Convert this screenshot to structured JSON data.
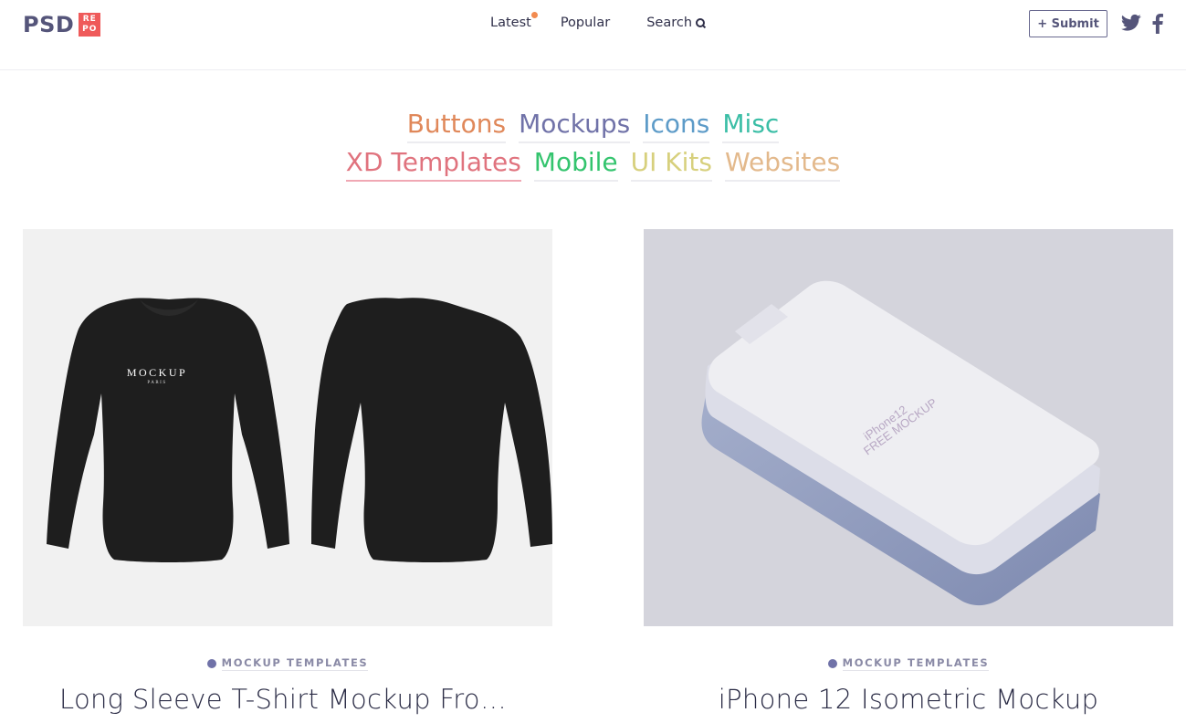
{
  "header": {
    "logo_main": "PSD",
    "logo_badge": [
      "RE",
      "PO"
    ],
    "nav": [
      {
        "label": "Latest",
        "has_new_dot": true
      },
      {
        "label": "Popular"
      },
      {
        "label": "Search",
        "icon": "search-icon"
      }
    ],
    "submit_label": "+ Submit",
    "social": [
      "twitter-icon",
      "facebook-icon"
    ]
  },
  "categories": {
    "row1": [
      {
        "label": "Buttons",
        "color": "#e0885a"
      },
      {
        "label": "Mockups",
        "color": "#7072a8"
      },
      {
        "label": "Icons",
        "color": "#5d9bc8"
      },
      {
        "label": "Misc",
        "color": "#3bbea6"
      }
    ],
    "row2": [
      {
        "label": "XD Templates",
        "color": "#e0737e"
      },
      {
        "label": "Mobile",
        "color": "#34c46e"
      },
      {
        "label": "UI Kits",
        "color": "#d7d07d"
      },
      {
        "label": "Websites",
        "color": "#e3b98c"
      }
    ]
  },
  "cards": [
    {
      "category": "MOCKUP TEMPLATES",
      "title": "Long Sleeve T-Shirt Mockup Front and Back",
      "thumb_text": {
        "brand": "MOCKUP",
        "sub": "PARIS"
      }
    },
    {
      "category": "MOCKUP TEMPLATES",
      "title": "iPhone 12 Isometric Mockup",
      "thumb_text": {
        "line1": "iPhone12",
        "line2": "FREE MOCKUP"
      }
    }
  ],
  "colors": {
    "brand": "#55557a",
    "badge": "#ef5a5a",
    "new_dot": "#f28b50",
    "category_dot": "#7072a8"
  }
}
